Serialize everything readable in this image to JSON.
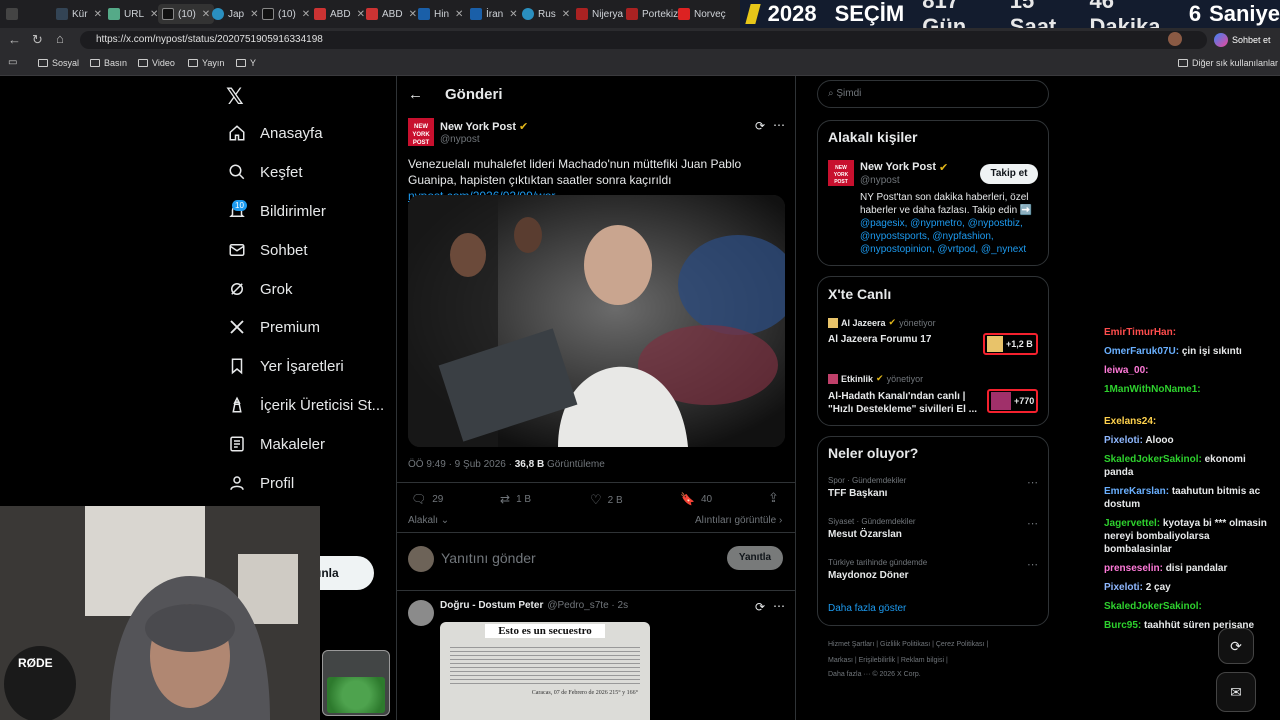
{
  "browser": {
    "tabs": [
      "Kür",
      "URL",
      "(10)",
      "Jap",
      "(10)",
      "ABD",
      "ABD",
      "Hin",
      "İran",
      "Rus",
      "Nijerya",
      "Portekiz",
      "Norveç"
    ],
    "url": "https://x.com/nypost/status/2020751905916334198",
    "banner": [
      "2028",
      "SEÇİM",
      "817 Gün",
      "15 Saat",
      "46 Dakika",
      "6",
      "Saniye"
    ],
    "chat_button": "Sohbet et",
    "bookmarks": [
      "Sosyal",
      "Basın",
      "Video",
      "Yayın",
      "Y"
    ],
    "other_bookmarks": "Diğer sık kullanılanlar"
  },
  "sidebar": {
    "items": [
      "Anasayfa",
      "Keşfet",
      "Bildirimler",
      "Sohbet",
      "Grok",
      "Premium",
      "Yer İşaretleri",
      "İçerik Üreticisi St...",
      "Makaleler",
      "Profil"
    ],
    "notif_badge": "10",
    "post_button": "ınla"
  },
  "post": {
    "header": "Gönderi",
    "author": "New York Post",
    "handle": "@nypost",
    "text": "Venezuelalı muhalefet lideri Machado'nun müttefiki Juan Pablo Guanipa, hapisten çıktıktan saatler sonra kaçırıldı",
    "link": "nypost.com/2026/02/09/wor...",
    "time": "ÖÖ 9:49 · 9 Şub 2026 ·",
    "views": "36,8 B",
    "views_label": "Görüntüleme",
    "replies": "29",
    "reposts": "1 B",
    "likes": "2 B",
    "bookmarks": "40",
    "sort": "Alakalı",
    "quotes": "Alıntıları görüntüle",
    "reply_placeholder": "Yanıtını gönder",
    "reply_button": "Yanıtla"
  },
  "reply": {
    "author": "Doğru - Dostum Peter",
    "handle": "@Pedro_s7te · 2s",
    "image_title": "Esto es un secuestro",
    "image_footer": "Caracas, 07 de Febrero de 2026 215° y 166°"
  },
  "right": {
    "search_placeholder": "Şimdi",
    "related_title": "Alakalı kişiler",
    "rel_name": "New York Post",
    "rel_handle": "@nypost",
    "follow": "Takip et",
    "rel_bio": "NY Post'tan son dakika haberleri, özel haberler ve daha fazlası. Takip edin ➡️",
    "rel_links": "@pagesix, @nypmetro, @nypostbiz, @nypostsports, @nypfashion, @nypostopinion, @vrtpod, @_nynext",
    "live_title": "X'te Canlı",
    "live1_host": "Al Jazeera",
    "live1_status": "yönetiyor",
    "live1_title": "Al Jazeera Forumu 17",
    "live1_count": "+1,2 B",
    "live2_host": "Etkinlik",
    "live2_status": "yönetiyor",
    "live2_title": "Al-Hadath Kanalı'ndan canlı | \"Hızlı Destekleme\" sivilleri El ...",
    "live2_count": "+770",
    "trends_title": "Neler oluyor?",
    "trends": [
      {
        "cat": "Spor · Gündemdekiler",
        "name": "TFF Başkanı"
      },
      {
        "cat": "Siyaset · Gündemdekiler",
        "name": "Mesut Özarslan"
      },
      {
        "cat": "Türkiye tarihinde gündemde",
        "name": "Maydonoz Döner"
      }
    ],
    "show_more": "Daha fazla göster",
    "footer1": "Hizmet Şartları  |  Gizlilik Politikası  |  Çerez Politikası  |",
    "footer2": "Markası  |  Erişilebilirlik  |  Reklam bilgisi  |",
    "footer3": "Daha fazla ···   © 2026 X Corp."
  },
  "chat": [
    {
      "user": "EmirTimurHan:",
      "msg": "",
      "color": "#ff4d4d"
    },
    {
      "user": "OmerFaruk07U:",
      "msg": "çin işi sıkıntı",
      "color": "#6ab0ff"
    },
    {
      "user": "leiwa_00:",
      "msg": "",
      "color": "#ff7ad9"
    },
    {
      "user": "1ManWithNoName1:",
      "msg": "",
      "color": "#2ed12e"
    },
    {
      "user": "Exelans24:",
      "msg": "",
      "color": "#ffd24d"
    },
    {
      "user": "Pixeloti:",
      "msg": "Alooo",
      "color": "#8fb8ff"
    },
    {
      "user": "SkaledJokerSakinol:",
      "msg": "ekonomi panda",
      "color": "#2ed12e"
    },
    {
      "user": "EmreKarslan:",
      "msg": "taahutun bitmis ac dostum",
      "color": "#6ab0ff"
    },
    {
      "user": "Jagervettel:",
      "msg": "kyotaya bi *** olmasin nereyi bombaliyolarsa bombalasinlar",
      "color": "#2ed12e"
    },
    {
      "user": "prenseselin:",
      "msg": "disi pandalar",
      "color": "#ff7ad9"
    },
    {
      "user": "Pixeloti:",
      "msg": "2 çay",
      "color": "#8fb8ff"
    },
    {
      "user": "SkaledJokerSakinol:",
      "msg": "",
      "color": "#2ed12e"
    },
    {
      "user": "Burc95:",
      "msg": "taahhüt süren perişane",
      "color": "#2ed12e"
    }
  ],
  "colors": {
    "accent": "#1d9bf0",
    "verified": "#e2b719",
    "bg": "#000000"
  }
}
